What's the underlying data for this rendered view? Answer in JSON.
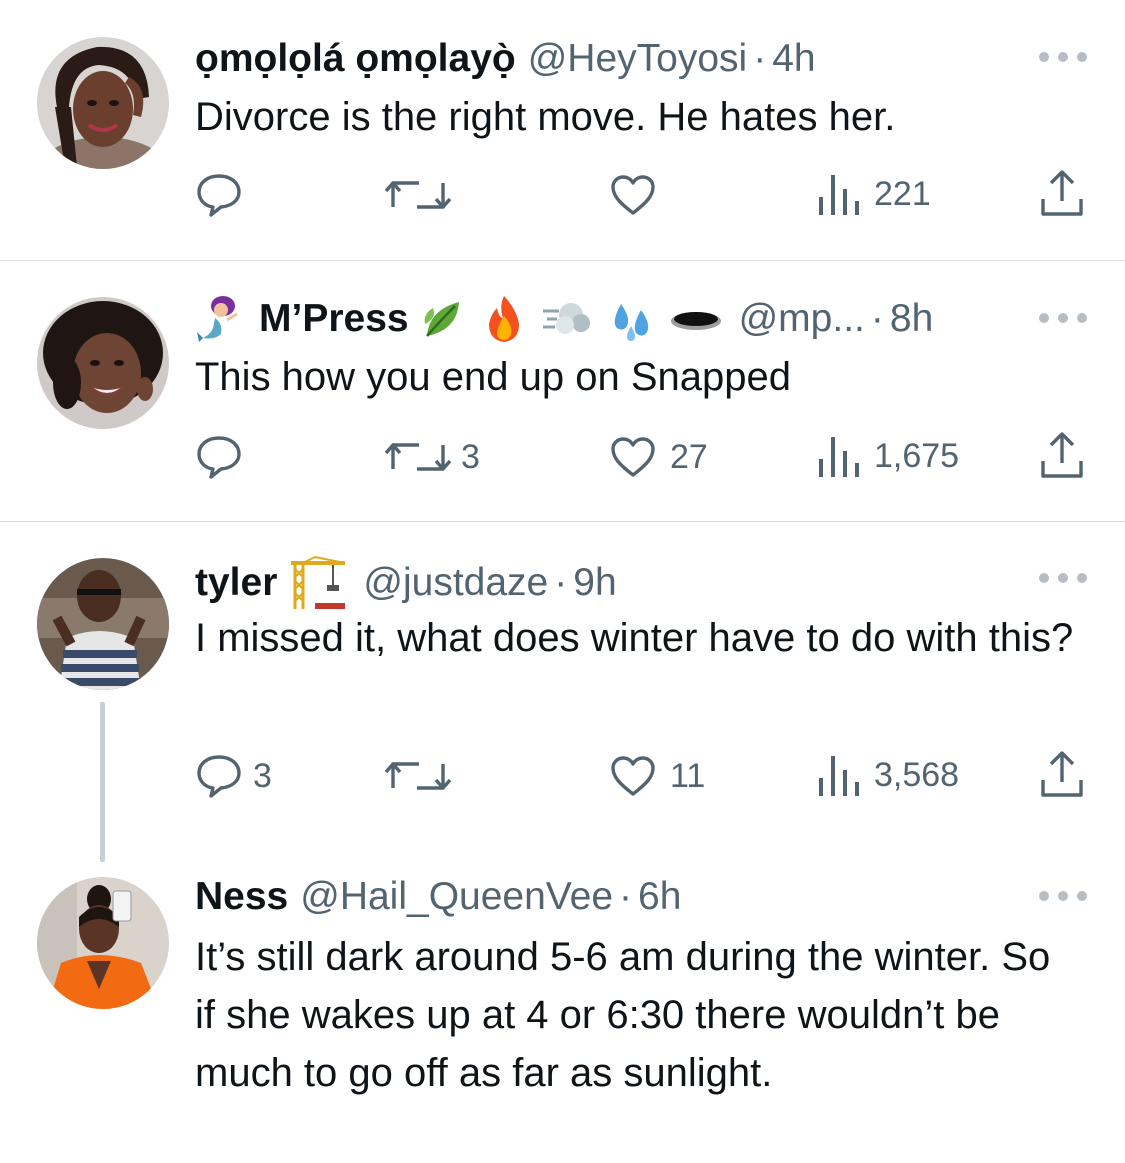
{
  "tweets": [
    {
      "name": "ọmọlọlá ọmọlayọ̀",
      "handle": "@HeyToyosi",
      "separator": "·",
      "time": "4h",
      "text": "Divorce is the right move. He hates her.",
      "replies": "",
      "retweets": "",
      "likes": "",
      "views": "221"
    },
    {
      "name": "M’Press",
      "name_emoji": [
        "mermaid-emoji",
        "herb-emoji",
        "fire-emoji",
        "dash-emoji",
        "sweat-droplets-emoji",
        "hole-emoji"
      ],
      "handle": "@mp...",
      "separator": "·",
      "time": "8h",
      "text": "This how you end up on Snapped",
      "replies": "",
      "retweets": "3",
      "likes": "27",
      "views": "1,675"
    },
    {
      "name": "tyler",
      "name_emoji": [
        "building-construction-emoji"
      ],
      "handle": "@justdaze",
      "separator": "·",
      "time": "9h",
      "text": "I missed it, what does winter have to do with this?",
      "replies": "3",
      "retweets": "",
      "likes": "11",
      "views": "3,568"
    },
    {
      "name": "Ness",
      "handle": "@Hail_QueenVee",
      "separator": "·",
      "time": "6h",
      "text": "It’s still dark around 5-6 am during the winter. So if she wakes up at 4 or 6:30 there wouldn’t be much to go off as far as sunlight."
    }
  ],
  "colors": {
    "text": "#0f1419",
    "secondary": "#536471",
    "divider": "#d9dee2",
    "thread_line": "#c8ced3",
    "more_dots": "#b7bdc2"
  },
  "icons": {
    "reply": "speech-bubble-icon",
    "retweet": "retweet-arrows-icon",
    "like": "heart-icon",
    "views": "bar-chart-icon",
    "share": "share-upload-icon",
    "more": "ellipsis-icon"
  }
}
